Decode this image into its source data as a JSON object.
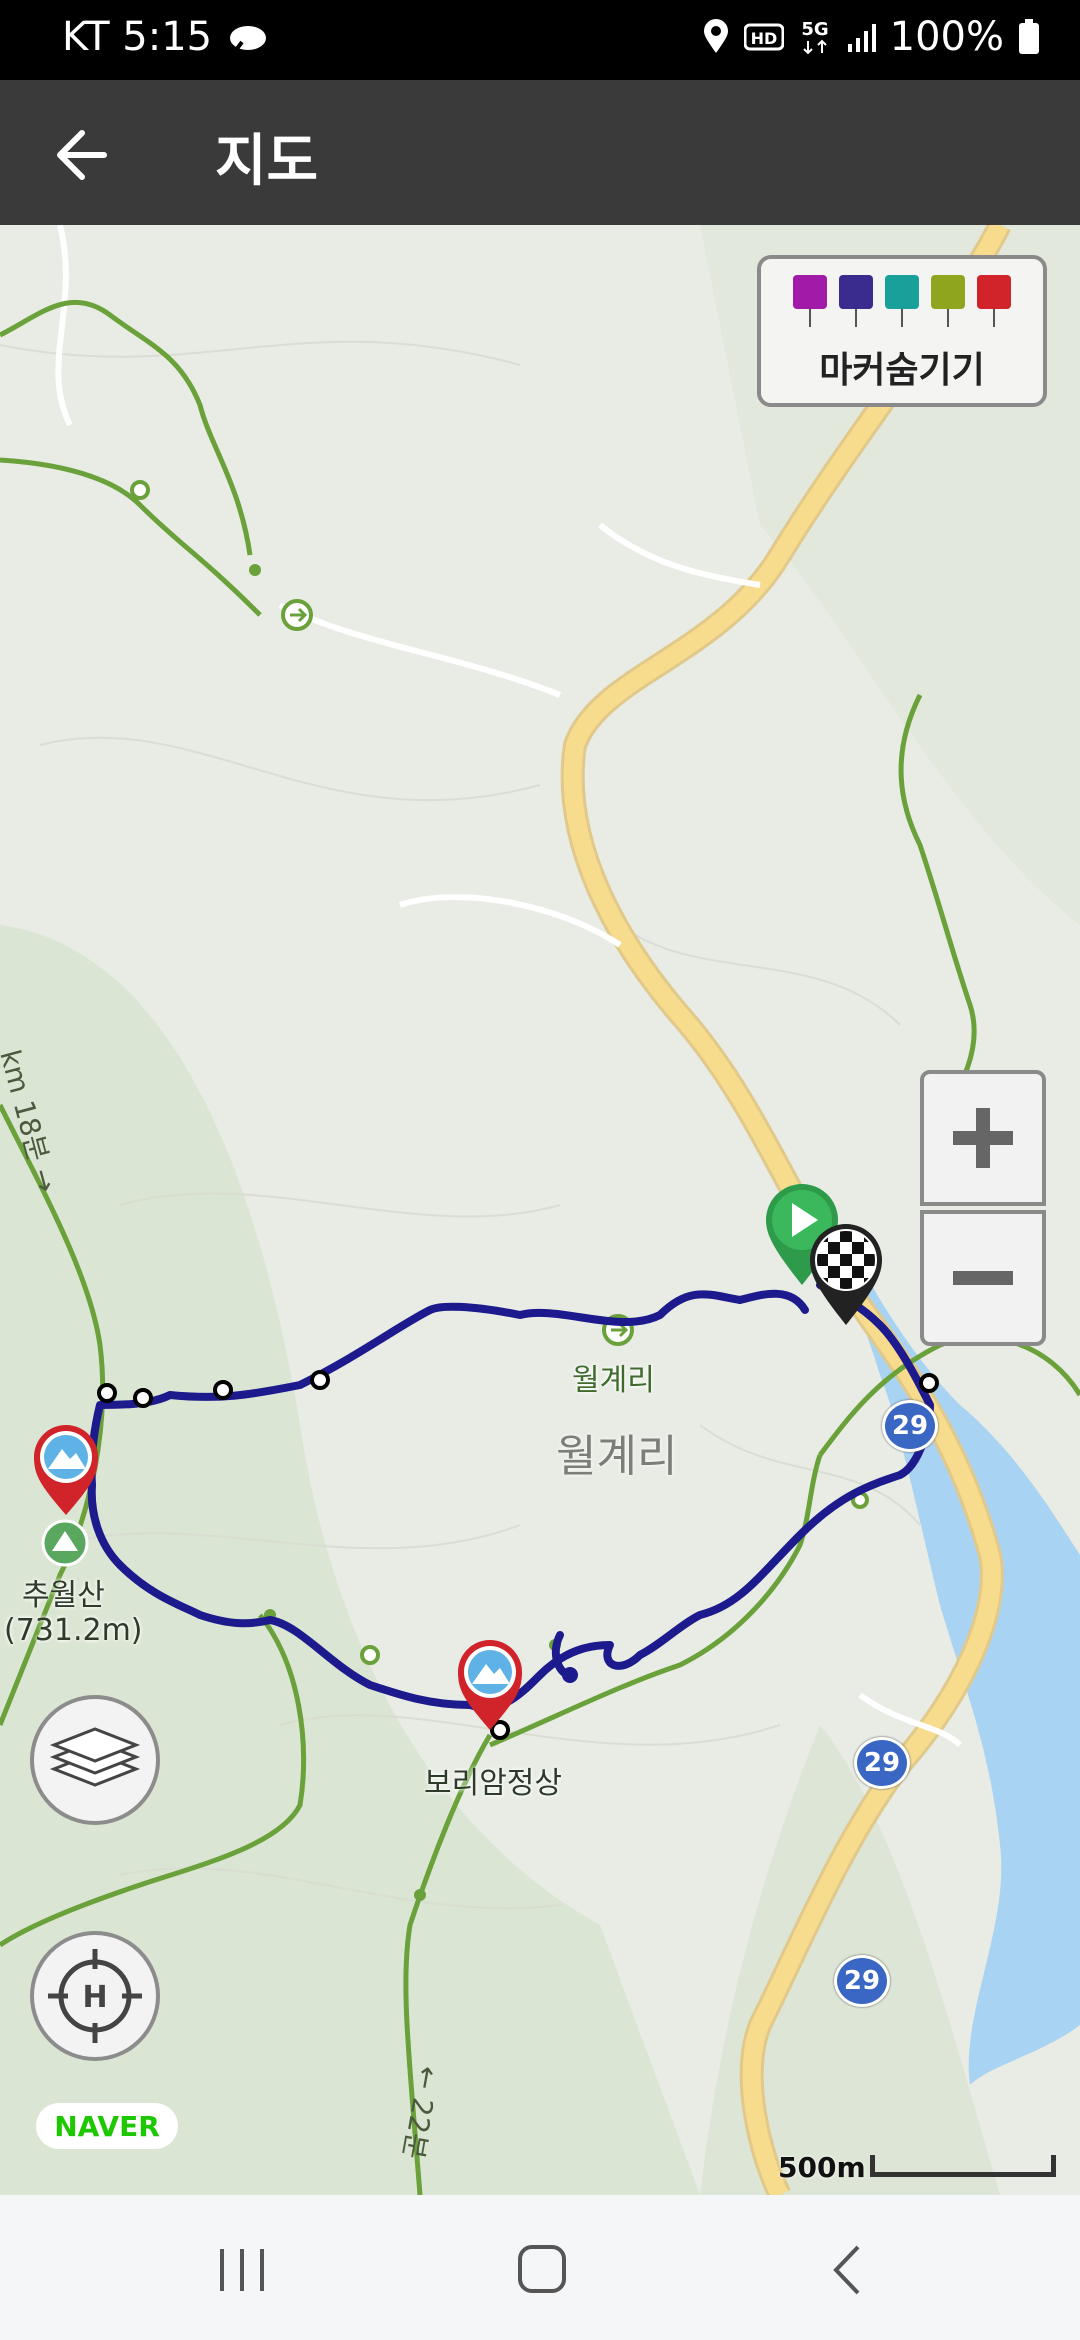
{
  "status_bar": {
    "carrier_time": "KT 5:15",
    "network": "5G",
    "hd": "HD",
    "battery": "100%",
    "icons": [
      "weather-icon",
      "location-icon",
      "hd-icon",
      "5g-icon",
      "signal-icon",
      "battery-icon"
    ]
  },
  "app_bar": {
    "title": "지도",
    "back_icon": "back-arrow-icon"
  },
  "map": {
    "marker_toggle": {
      "label": "마커숨기기",
      "icons": [
        {
          "name": "camera-marker-icon",
          "color": "#a11aa8"
        },
        {
          "name": "video-marker-icon",
          "color": "#3a2c8f"
        },
        {
          "name": "voice-marker-icon",
          "color": "#1aa09a"
        },
        {
          "name": "memo-marker-icon",
          "color": "#8fa51e"
        },
        {
          "name": "location-marker-icon",
          "color": "#d0232a"
        }
      ]
    },
    "labels": {
      "village_small": "월계리",
      "village_large": "월계리",
      "peak_name": "추월산",
      "peak_elevation": "(731.2m)",
      "viewpoint": "보리암정상",
      "trail_top": "km 18분 →",
      "trail_bottom": "← 22분"
    },
    "road_shields": [
      "29",
      "29",
      "29"
    ],
    "route_color": "#1c1a8c",
    "trail_color": "#6aa13a",
    "road_color": "#f7dc8e",
    "water_color": "#a9d3f2",
    "zoom_in_icon": "plus-icon",
    "zoom_out_icon": "minus-icon",
    "layers_icon": "layers-icon",
    "locate_icon": "home-crosshair-icon",
    "provider": "NAVER",
    "scale": "500m"
  },
  "nav_bar": {
    "recent_icon": "recent-apps-icon",
    "home_icon": "home-icon",
    "back_icon": "back-icon"
  }
}
